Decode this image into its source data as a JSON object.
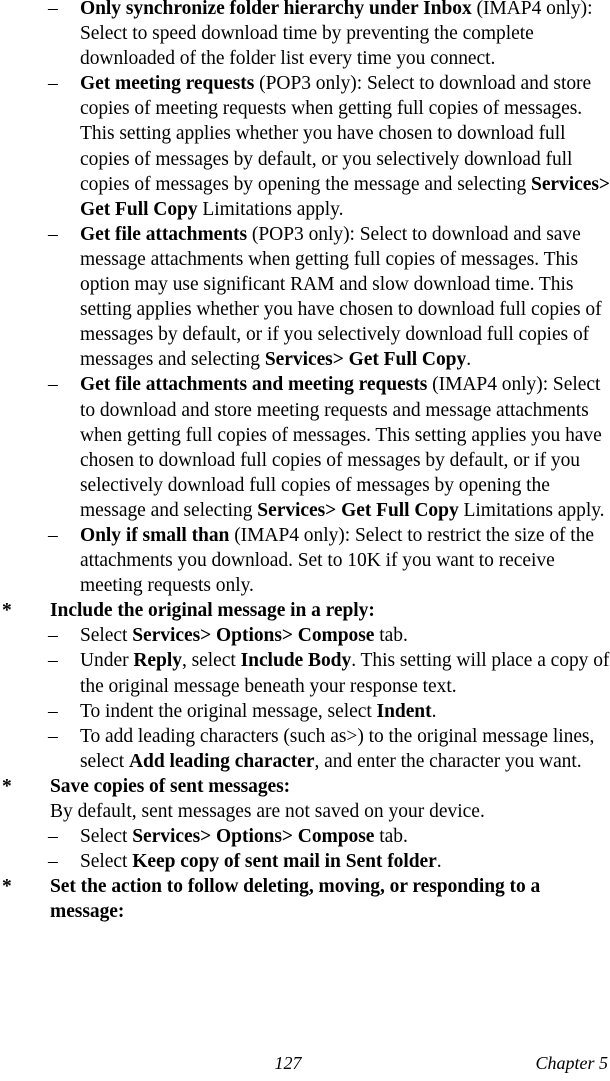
{
  "page": {
    "folio": "127",
    "chapter_label": "Chapter 5",
    "star_marker": "*",
    "dash_marker": "–"
  },
  "body": {
    "bullets": [
      {
        "marker": "–",
        "lead_bold": "Only synchronize folder hierarchy under Inbox",
        "text": " (IMAP4 only): Select to speed download time by preventing the complete downloaded of the folder list every time you connect.",
        "full_text": "Only synchronize folder hierarchy under Inbox (IMAP4 only): Select to speed download time by preventing the complete downloaded of the folder list every time you connect."
      },
      {
        "marker": "–",
        "lead_bold": "Get meeting requests",
        "text": " (POP3 only): Select to download and store copies of meeting requests when getting full copies of messages. This setting applies whether you have chosen to download full copies of messages by default, or you selectively download full copies of messages by opening the message and selecting ",
        "inline_bold": "Services> Get Full Copy",
        "tail": " Limitations apply.",
        "full_text": "Get meeting requests (POP3 only): Select to download and store copies of meeting requests when getting full copies of messages. This setting applies whether you have chosen to download full copies of messages by default, or you selectively download full copies of messages by opening the message and selecting Services> Get Full Copy Limitations apply."
      },
      {
        "marker": "–",
        "lead_bold": "Get file attachments",
        "text": " (POP3 only): Select to download and save message attachments when getting full copies of messages. This option may use significant RAM and slow download time. This setting applies whether you have chosen to download full copies of messages by default, or if you selectively download full copies of messages and selecting ",
        "inline_bold": "Services> Get Full Copy",
        "tail": ".",
        "full_text": "Get file attachments (POP3 only): Select to download and save message attachments when getting full copies of messages. This option may use significant RAM and slow download time. This setting applies whether you have chosen to download full copies of messages by default, or if you selectively download full copies of messages and selecting Services> Get Full Copy."
      },
      {
        "marker": "–",
        "lead_bold": "Get file attachments and meeting requests",
        "text": " (IMAP4 only): Select to download and store meeting requests and message attachments when getting full copies of messages. This setting applies you have chosen to download full copies of messages by default, or if you selectively download full copies of messages by opening the message and selecting ",
        "inline_bold": "Services> Get Full Copy",
        "tail": " Limitations apply.",
        "full_text": "Get file attachments and meeting requests (IMAP4 only): Select to download and store meeting requests and message attachments when getting full copies of messages. This setting applies you have chosen to download full copies of messages by default, or if you selectively download full copies of messages by opening the message and selecting Services> Get Full Copy Limitations apply."
      },
      {
        "marker": "–",
        "lead_bold": "Only if small than",
        "text": " (IMAP4 only): Select to restrict the size of the attachments you download. Set to 10K if you want to receive meeting requests only.",
        "full_text": "Only if small than (IMAP4 only): Select to restrict the size of the attachments you download. Set to 10K if you want to receive meeting requests only."
      }
    ],
    "sections": [
      {
        "marker": "*",
        "heading": "Include the original message in a reply:",
        "intro": "",
        "steps": [
          {
            "marker": "–",
            "pre": "Select ",
            "bold": "Services> Options> Compose",
            "post": " tab.",
            "full_text": "Select Services> Options> Compose tab."
          },
          {
            "marker": "–",
            "pre": "Under ",
            "bold": "Reply",
            "mid": ", select ",
            "bold2": "Include Body",
            "post": ". This setting will place a copy of the original message beneath your response text.",
            "full_text": "Under Reply, select Include Body. This setting will place a copy of the original message beneath your response text."
          },
          {
            "marker": "–",
            "pre": "To indent the original message, select ",
            "bold": "Indent",
            "post": ".",
            "full_text": "To indent the original message, select Indent."
          },
          {
            "marker": "–",
            "pre": "To add leading characters (such as>) to the original message lines, select ",
            "bold": "Add leading character",
            "post": ", and enter the character you want.",
            "full_text": "To add leading characters (such as>) to the original message lines, select Add leading character, and enter the character you want."
          }
        ]
      },
      {
        "marker": "*",
        "heading": "Save copies of sent messages:",
        "intro": "By default, sent messages are not saved on your device.",
        "steps": [
          {
            "marker": "–",
            "pre": "Select ",
            "bold": "Services> Options> Compose",
            "post": " tab.",
            "full_text": "Select Services> Options> Compose tab."
          },
          {
            "marker": "–",
            "pre": "Select ",
            "bold": "Keep copy of sent mail in Sent folder",
            "post": ".",
            "full_text": "Select Keep copy of sent mail in Sent folder."
          }
        ]
      },
      {
        "marker": "*",
        "heading": "Set the action to follow deleting, moving, or responding to a message:",
        "intro": "",
        "steps": []
      }
    ]
  }
}
